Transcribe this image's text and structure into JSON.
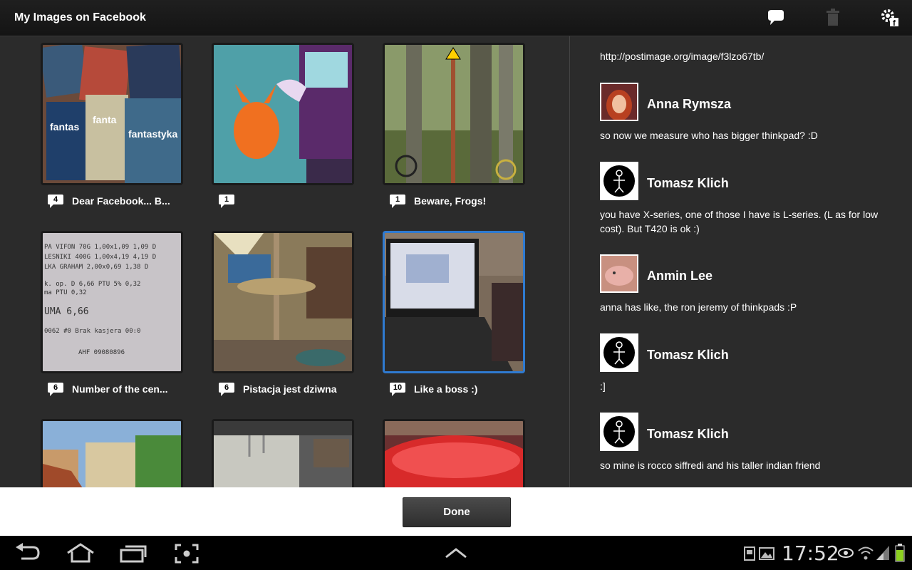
{
  "app": {
    "title": "My Images on Facebook"
  },
  "grid": {
    "tiles": [
      {
        "count": "4",
        "caption": "Dear Facebook... B..."
      },
      {
        "count": "1",
        "caption": ""
      },
      {
        "count": "1",
        "caption": "Beware, Frogs!"
      },
      {
        "count": "6",
        "caption": "Number of the cen..."
      },
      {
        "count": "6",
        "caption": "Pistacja jest dziwna"
      },
      {
        "count": "10",
        "caption": "Like a boss :)"
      }
    ]
  },
  "comments": {
    "url": "http://postimage.org/image/f3lzo67tb/",
    "items": [
      {
        "author": "Anna Rymsza",
        "text": "so now we measure who has bigger thinkpad? :D"
      },
      {
        "author": "Tomasz Klich",
        "text": "you have X-series, one of those I have is L-series. (L as for low cost). But T420 is ok :)"
      },
      {
        "author": "Anmin Lee",
        "text": "anna has like, the ron jeremy of thinkpads :P"
      },
      {
        "author": "Tomasz Klich",
        "text": ":]"
      },
      {
        "author": "Tomasz Klich",
        "text": "so mine is rocco siffredi and his taller indian friend"
      }
    ]
  },
  "bottom": {
    "done_label": "Done"
  },
  "status": {
    "time": "17:52"
  },
  "icons": {
    "comment": "comment-icon",
    "delete": "trash-icon",
    "settings": "settings-facebook-icon",
    "back": "back-icon",
    "home": "home-icon",
    "recents": "recent-apps-icon",
    "screenshot": "screenshot-icon",
    "up": "chevron-up-icon"
  },
  "colors": {
    "accent": "#2f7ad0",
    "actionbar": "#1a1a1a",
    "background": "#2b2b2b"
  }
}
